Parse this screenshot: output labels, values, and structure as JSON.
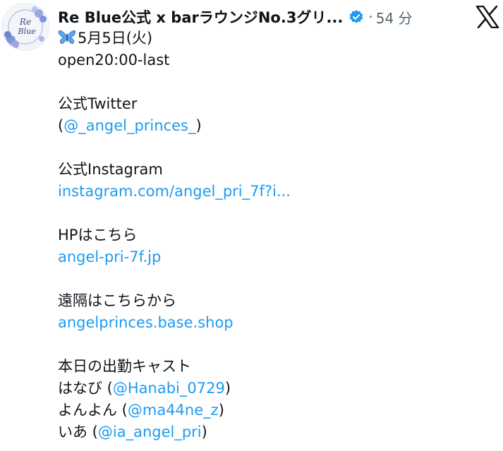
{
  "author": {
    "avatar_text": "Re Blue",
    "name": "Re Blue公式 x barラウンジNo.3グリ...",
    "time": "54 分",
    "dot": "·"
  },
  "post": {
    "date_line": "5月5日(火)",
    "open_line": "open20:00-last",
    "twitter_heading": "公式Twitter",
    "twitter_open": "(",
    "twitter_handle": "@_angel_princes_",
    "twitter_close": ")",
    "instagram_heading": "公式Instagram",
    "instagram_link": "instagram.com/angel_pri_7f?i...",
    "hp_heading": "HPはこちら",
    "hp_link": "angel-pri-7f.jp",
    "remote_heading": "遠隔はこちらから",
    "remote_link": "angelprinces.base.shop",
    "cast_heading": "本日の出勤キャスト",
    "cast": [
      {
        "name": "はなび",
        "open": " (",
        "handle": "@Hanabi_0729",
        "close": ")"
      },
      {
        "name": "よんよん",
        "open": " (",
        "handle": "@ma44ne_z",
        "close": ")"
      },
      {
        "name": "いあ",
        "open": " (",
        "handle": "@ia_angel_pri",
        "close": ")"
      }
    ]
  },
  "colors": {
    "link": "#1d9bf0",
    "text": "#0f1419",
    "muted": "#536471",
    "verified": "#1d9bf0"
  },
  "icons": {
    "verified": "verified-badge-icon",
    "platform": "x-logo-icon",
    "emoji": "butterfly-icon"
  }
}
